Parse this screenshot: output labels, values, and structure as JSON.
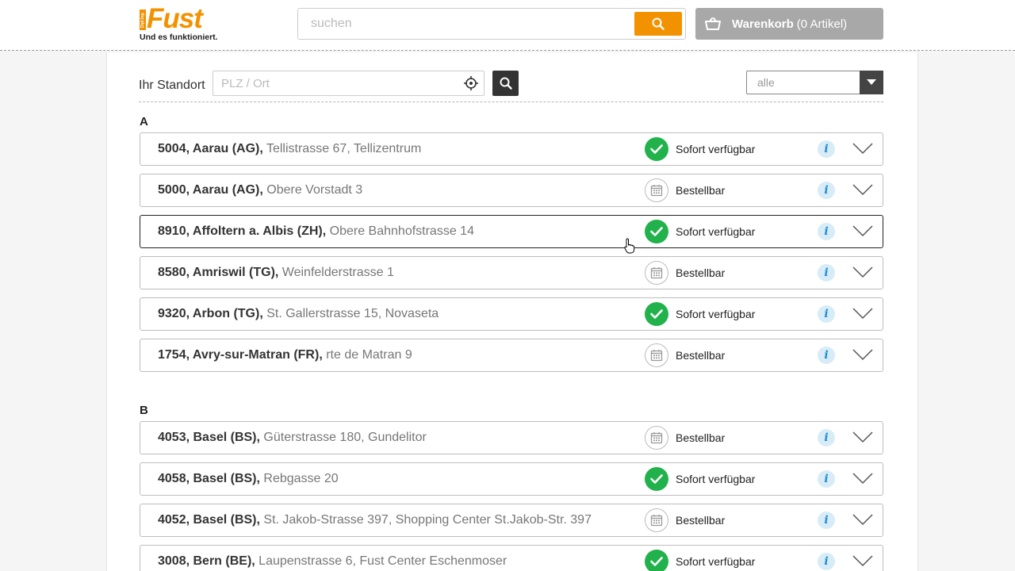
{
  "header": {
    "logo_word": "Fust",
    "logo_vertical": "Dipl.Ing.",
    "logo_tagline": "Und es funktioniert.",
    "search_placeholder": "suchen",
    "cart_label": "Warenkorb",
    "cart_count": "(0 Artikel)"
  },
  "locator": {
    "label": "Ihr Standort",
    "plz_placeholder": "PLZ / Ort",
    "filter_value": "alle"
  },
  "colors": {
    "brand": "#f39200",
    "available": "#22b24c",
    "info": "#1f8dd6"
  },
  "groups": [
    {
      "letter": "A",
      "stores": [
        {
          "name": "5004, Aarau (AG),",
          "address": " Tellistrasse 67, Tellizentrum",
          "status": "Sofort verfügbar",
          "icon": "check-icon"
        },
        {
          "name": "5000, Aarau (AG),",
          "address": " Obere Vorstadt 3",
          "status": "Bestellbar",
          "icon": "calendar-icon"
        },
        {
          "name": "8910, Affoltern a. Albis (ZH),",
          "address": " Obere Bahnhofstrasse 14",
          "status": "Sofort verfügbar",
          "icon": "check-icon"
        },
        {
          "name": "8580, Amriswil (TG),",
          "address": " Weinfelderstrasse 1",
          "status": "Bestellbar",
          "icon": "calendar-icon"
        },
        {
          "name": "9320, Arbon (TG),",
          "address": " St. Gallerstrasse 15, Novaseta",
          "status": "Sofort verfügbar",
          "icon": "check-icon"
        },
        {
          "name": "1754, Avry-sur-Matran (FR),",
          "address": " rte de Matran 9",
          "status": "Bestellbar",
          "icon": "calendar-icon"
        }
      ]
    },
    {
      "letter": "B",
      "stores": [
        {
          "name": "4053, Basel (BS),",
          "address": " Güterstrasse 180, Gundelitor",
          "status": "Bestellbar",
          "icon": "calendar-icon"
        },
        {
          "name": "4058, Basel (BS),",
          "address": " Rebgasse 20",
          "status": "Sofort verfügbar",
          "icon": "check-icon"
        },
        {
          "name": "4052, Basel (BS),",
          "address": " St. Jakob-Strasse 397, Shopping Center St.Jakob-Str. 397",
          "status": "Bestellbar",
          "icon": "calendar-icon"
        },
        {
          "name": "3008, Bern (BE),",
          "address": " Laupenstrasse 6, Fust Center Eschenmoser",
          "status": "Sofort verfügbar",
          "icon": "check-icon"
        }
      ]
    }
  ],
  "info_glyph": "i"
}
